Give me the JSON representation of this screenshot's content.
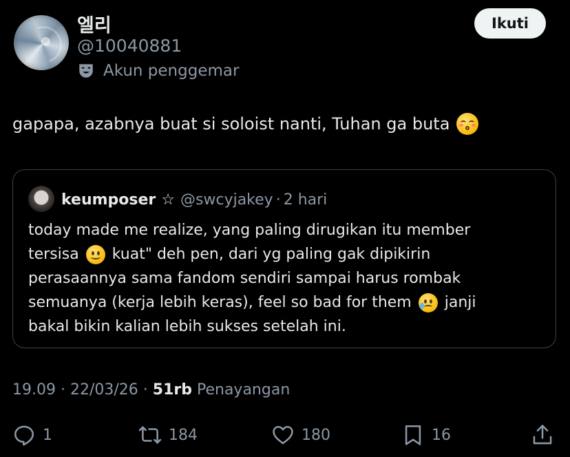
{
  "author": {
    "name": "엘리",
    "handle": "@10040881",
    "label": "Akun penggemar",
    "label_icon": "theater-masks-icon"
  },
  "follow_button": {
    "label": "Ikuti"
  },
  "tweet": {
    "text": "gapapa, azabnya buat si soloist nanti, Tuhan ga buta",
    "emoji": "kissing-face-smiling-eyes"
  },
  "quoted": {
    "name": "keumposer",
    "name_suffix": "☆",
    "handle": "@swcyjakey",
    "separator": "·",
    "time": "2 hari",
    "lines": [
      {
        "text": "today made me realize, yang paling dirugikan itu member"
      },
      {
        "before": "tersisa",
        "emoji": "slightly-smiling-face",
        "after": "kuat\" deh pen, dari yg paling gak dipikirin"
      },
      {
        "text": "perasaannya sama fandom sendiri sampai harus rombak"
      },
      {
        "before": "semuanya (kerja lebih keras), feel so bad for them",
        "emoji": "face-holding-back-tears",
        "after": "janji"
      },
      {
        "text": "bakal bikin kalian lebih sukses setelah ini."
      }
    ]
  },
  "meta": {
    "time": "19.09",
    "sep": " · ",
    "date": "22/03/26",
    "views_count": "51rb",
    "views_label": "Penayangan"
  },
  "actions": {
    "replies": "1",
    "reposts": "184",
    "likes": "180",
    "bookmarks": "16"
  },
  "colors": {
    "background": "#000000",
    "text": "#e7e9ea",
    "muted": "#8b98a5",
    "border": "#3e4144",
    "button_bg": "#eff3f4"
  }
}
